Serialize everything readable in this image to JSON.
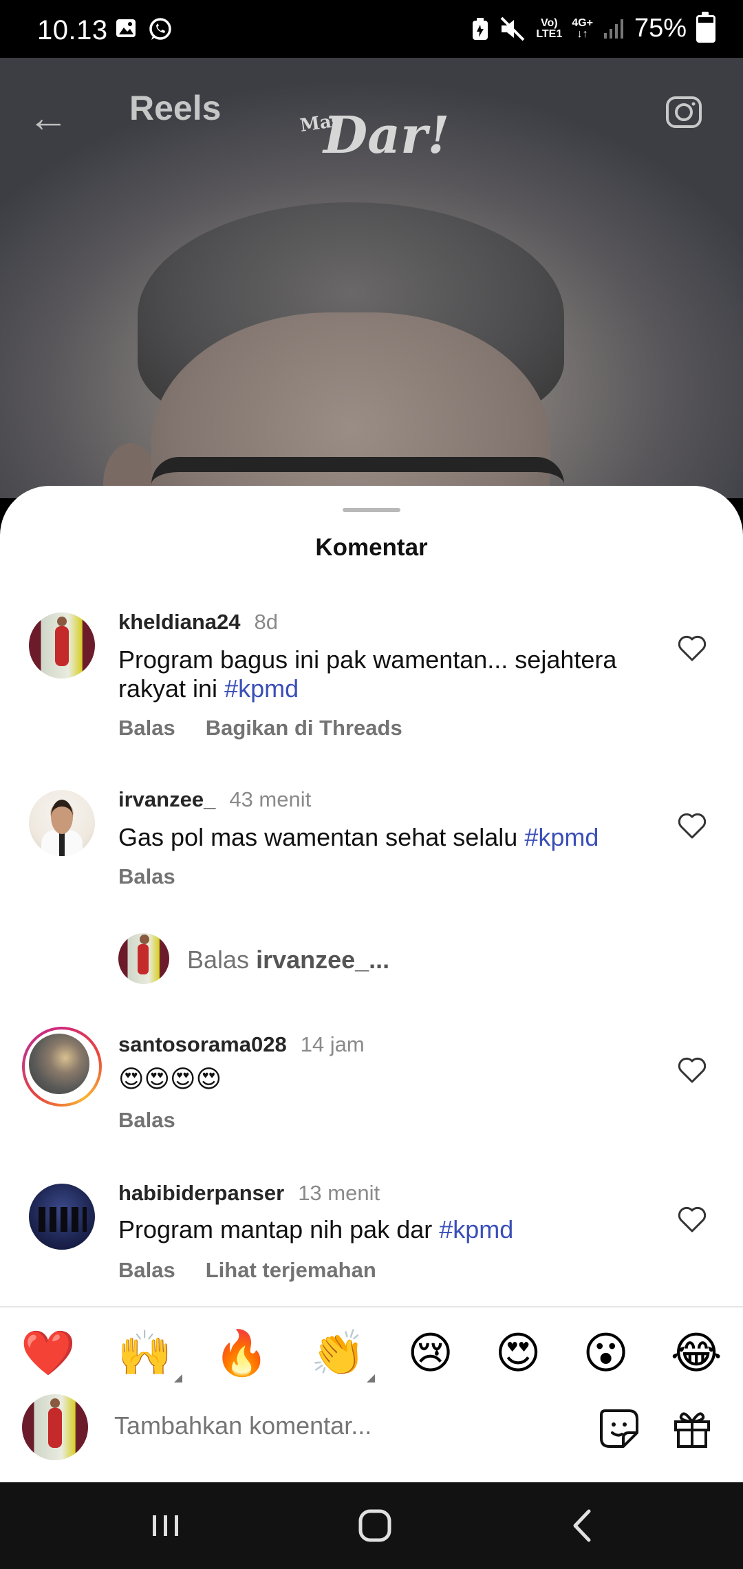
{
  "status_bar": {
    "time": "10.13",
    "network_top": "Vo)",
    "network_bottom": "LTE1",
    "signal_type": "4G+",
    "battery": "75%",
    "battery_level": 0.75,
    "icons": [
      "gallery-icon",
      "whatsapp-icon",
      "battery-saver-icon",
      "mute-icon",
      "signal-icon",
      "battery-icon"
    ]
  },
  "video": {
    "header_title": "Reels",
    "watermark_prefix": "Mas",
    "watermark": "Dar!",
    "icons": [
      "back-arrow-icon",
      "camera-icon"
    ]
  },
  "sheet": {
    "title": "Komentar"
  },
  "comments": [
    {
      "username": "kheldiana24",
      "time": "8d",
      "text": "Program bagus ini pak wamentan... sejahtera rakyat ini ",
      "hashtag": "#kpmd",
      "actions": [
        "Balas",
        "Bagikan di Threads"
      ]
    },
    {
      "username": "irvanzee_",
      "time": "43 menit",
      "text": "Gas pol mas wamentan sehat selalu ",
      "hashtag": "#kpmd",
      "actions": [
        "Balas"
      ]
    },
    {
      "username": "santosorama028",
      "time": "14 jam",
      "text": "😍😍😍😍",
      "hashtag": "",
      "actions": [
        "Balas"
      ]
    },
    {
      "username": "habibiderpanser",
      "time": "13 menit",
      "text": "Program mantap nih pak dar ",
      "hashtag": "#kpmd",
      "actions": [
        "Balas",
        "Lihat terjemahan"
      ]
    }
  ],
  "reply_prompt": {
    "prefix": "Balas ",
    "target": "irvanzee_..."
  },
  "emoji_bar": [
    "❤️",
    "🙌",
    "🔥",
    "👏",
    "😢",
    "😍",
    "😮",
    "😂"
  ],
  "input": {
    "placeholder": "Tambahkan komentar..."
  },
  "nav_bar": {
    "icons": [
      "recent-apps-icon",
      "home-icon",
      "back-icon"
    ]
  }
}
